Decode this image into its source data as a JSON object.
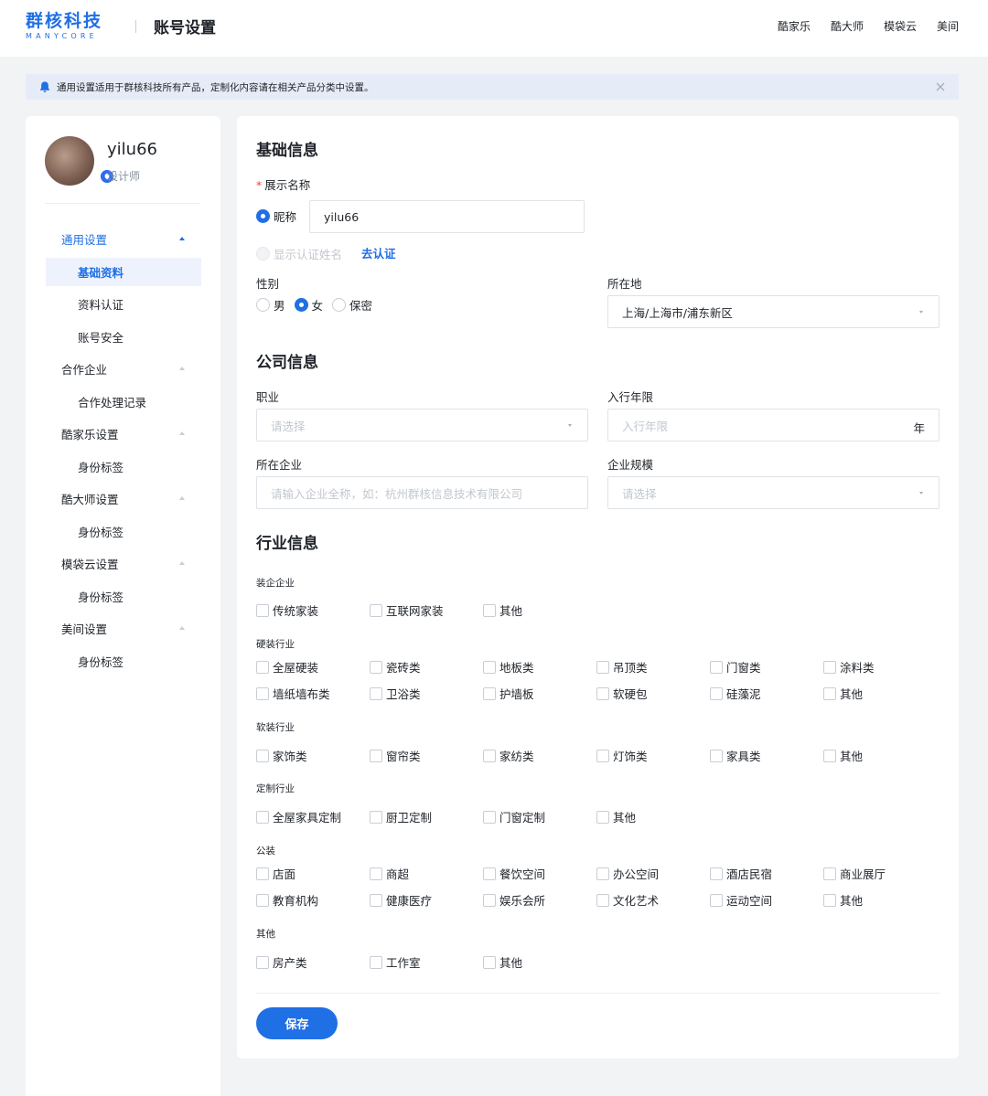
{
  "header": {
    "logo_text": "群核科技",
    "logo_sub": "MANYCORE",
    "page_title": "账号设置",
    "nav": [
      "酷家乐",
      "酷大师",
      "模袋云",
      "美间"
    ]
  },
  "notice": {
    "text": "通用设置适用于群核科技所有产品，定制化内容请在相关产品分类中设置。",
    "icon": "bell-icon",
    "close_icon": "close-icon"
  },
  "profile": {
    "name": "yilu66",
    "role": "设计师"
  },
  "sidebar": {
    "menu": [
      {
        "label": "通用设置",
        "type": "group",
        "active": true
      },
      {
        "label": "基础资料",
        "type": "item",
        "active": true
      },
      {
        "label": "资料认证",
        "type": "item"
      },
      {
        "label": "账号安全",
        "type": "item"
      },
      {
        "label": "合作企业",
        "type": "group"
      },
      {
        "label": "合作处理记录",
        "type": "item"
      },
      {
        "label": "酷家乐设置",
        "type": "group"
      },
      {
        "label": "身份标签",
        "type": "item"
      },
      {
        "label": "酷大师设置",
        "type": "group"
      },
      {
        "label": "身份标签",
        "type": "item"
      },
      {
        "label": "模袋云设置",
        "type": "group"
      },
      {
        "label": "身份标签",
        "type": "item"
      },
      {
        "label": "美间设置",
        "type": "group"
      },
      {
        "label": "身份标签",
        "type": "item"
      }
    ]
  },
  "basic": {
    "title": "基础信息",
    "display_name_label": "展示名称",
    "required_mark": "*",
    "nickname_option": "昵称",
    "nickname_value": "yilu66",
    "cert_name_option": "显示认证姓名",
    "cert_link": "去认证",
    "gender_label": "性别",
    "gender_options": [
      "男",
      "女",
      "保密"
    ],
    "gender_selected": "女",
    "location_label": "所在地",
    "location_value": "上海/上海市/浦东新区"
  },
  "company": {
    "title": "公司信息",
    "job_label": "职业",
    "job_placeholder": "请选择",
    "years_label": "入行年限",
    "years_placeholder": "入行年限",
    "years_suffix": "年",
    "company_label": "所在企业",
    "company_placeholder": "请输入企业全称，如：杭州群核信息技术有限公司",
    "size_label": "企业规模",
    "size_placeholder": "请选择"
  },
  "industry": {
    "title": "行业信息",
    "groups": [
      {
        "label": "装企企业",
        "rows": [
          [
            "传统家装",
            "互联网家装",
            "其他"
          ]
        ]
      },
      {
        "label": "硬装行业",
        "rows": [
          [
            "全屋硬装",
            "瓷砖类",
            "地板类",
            "吊顶类",
            "门窗类",
            "涂料类"
          ],
          [
            "墙纸墙布类",
            "卫浴类",
            "护墙板",
            "软硬包",
            "硅藻泥",
            "其他"
          ]
        ]
      },
      {
        "label": "软装行业",
        "rows": [
          [
            "家饰类",
            "窗帘类",
            "家纺类",
            "灯饰类",
            "家具类",
            "其他"
          ]
        ]
      },
      {
        "label": "定制行业",
        "rows": [
          [
            "全屋家具定制",
            "厨卫定制",
            "门窗定制",
            "其他"
          ]
        ]
      },
      {
        "label": "公装",
        "rows": [
          [
            "店面",
            "商超",
            "餐饮空间",
            "办公空间",
            "酒店民宿",
            "商业展厅"
          ],
          [
            "教育机构",
            "健康医疗",
            "娱乐会所",
            "文化艺术",
            "运动空间",
            "其他"
          ]
        ]
      },
      {
        "label": "其他",
        "rows": [
          [
            "房产类",
            "工作室",
            "其他"
          ]
        ]
      }
    ]
  },
  "actions": {
    "save": "保存"
  },
  "colors": {
    "accent": "#1f6fe5",
    "required": "#f53f3f",
    "notice_bg": "#e6ecf7",
    "page_bg": "#f2f3f5"
  }
}
